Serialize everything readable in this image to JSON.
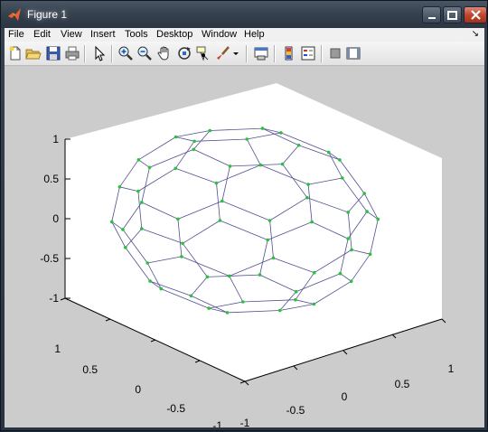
{
  "window": {
    "title": "Figure 1",
    "controls": {
      "minimize": "minimize",
      "maximize": "maximize",
      "close": "close"
    }
  },
  "menu": {
    "items": [
      "File",
      "Edit",
      "View",
      "Insert",
      "Tools",
      "Desktop",
      "Window",
      "Help"
    ],
    "dock_glyph": "↘"
  },
  "toolbar": {
    "buttons": [
      "new-figure-icon",
      "open-file-icon",
      "save-icon",
      "print-icon",
      "edit-plot-arrow-icon",
      "zoom-in-icon",
      "zoom-out-icon",
      "pan-hand-icon",
      "rotate-3d-icon",
      "data-cursor-icon",
      "brush-icon",
      "brush-dropdown-icon",
      "link-plot-icon",
      "insert-colorbar-icon",
      "insert-legend-icon",
      "hide-plot-tools-icon",
      "show-plot-tools-icon"
    ]
  },
  "axes": {
    "z_ticks": [
      "1",
      "0.5",
      "0",
      "-0.5",
      "-1"
    ],
    "y_ticks": [
      "1",
      "0.5",
      "0",
      "-0.5",
      "-1"
    ],
    "x_ticks": [
      "-1",
      "-0.5",
      "0",
      "0.5",
      "1"
    ]
  },
  "colors": {
    "axes_background": "#ffffff",
    "figure_background": "#cccccc",
    "edge_color": "#4f4f8f",
    "vertex_color": "#27c23a"
  }
}
